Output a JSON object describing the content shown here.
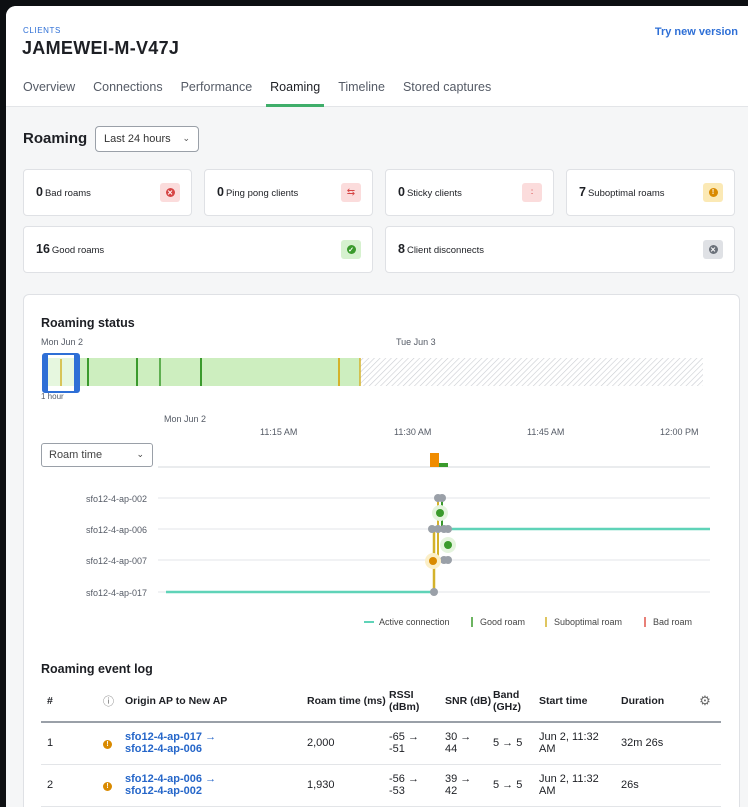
{
  "header": {
    "breadcrumb": "CLIENTS",
    "title": "JAMEWEI-M-V47J",
    "try_new": "Try new version"
  },
  "tabs": [
    {
      "label": "Overview"
    },
    {
      "label": "Connections"
    },
    {
      "label": "Performance"
    },
    {
      "label": "Roaming"
    },
    {
      "label": "Timeline"
    },
    {
      "label": "Stored captures"
    }
  ],
  "roaming": {
    "title": "Roaming",
    "range": "Last 24 hours"
  },
  "summary": [
    {
      "count": "0",
      "label": "Bad roams",
      "icon": "x-circle-icon"
    },
    {
      "count": "0",
      "label": "Ping pong clients",
      "icon": "ping-pong-icon"
    },
    {
      "count": "0",
      "label": "Sticky clients",
      "icon": "sticky-icon"
    },
    {
      "count": "7",
      "label": "Suboptimal roams",
      "icon": "warning-icon"
    },
    {
      "count": "16",
      "label": "Good roams",
      "icon": "check-circle-icon"
    },
    {
      "count": "8",
      "label": "Client disconnects",
      "icon": "disconnect-icon"
    }
  ],
  "status": {
    "title": "Roaming status",
    "day1": "Mon Jun 2",
    "day2": "Tue Jun 3",
    "window": "1 hour",
    "detail_date": "Mon Jun 2",
    "times": [
      "11:15 AM",
      "11:30 AM",
      "11:45 AM",
      "12:00 PM"
    ],
    "select": "Roam time",
    "aps": [
      "sfo12-4-ap-002",
      "sfo12-4-ap-006",
      "sfo12-4-ap-007",
      "sfo12-4-ap-017"
    ],
    "legend": [
      "Active connection",
      "Good roam",
      "Suboptimal roam",
      "Bad roam"
    ]
  },
  "colors": {
    "active": "#5fd3b8",
    "good": "#3a9a2c",
    "suboptimal": "#d4b22b",
    "bad": "#e0564a",
    "timeline_fill": "#cdeebf"
  },
  "log": {
    "title": "Roaming event log",
    "headers": {
      "num": "#",
      "path": "Origin AP to New AP",
      "roam_time": "Roam time (ms)",
      "rssi": "RSSI (dBm)",
      "snr": "SNR (dB)",
      "band": "Band (GHz)",
      "start": "Start time",
      "duration": "Duration"
    },
    "rows": [
      {
        "num": "1",
        "from": "sfo12-4-ap-017 →",
        "to": "sfo12-4-ap-006",
        "roam_time": "2,000",
        "rssi1": "-65 →",
        "rssi2": "-51",
        "snr1": "30 →",
        "snr2": "44",
        "band": "5 → 5",
        "start1": "Jun 2, 11:32",
        "start2": "AM",
        "duration": "32m 26s"
      },
      {
        "num": "2",
        "from": "sfo12-4-ap-006 →",
        "to": "sfo12-4-ap-002",
        "roam_time": "1,930",
        "rssi1": "-56 →",
        "rssi2": "-53",
        "snr1": "39 →",
        "snr2": "42",
        "band": "5 → 5",
        "start1": "Jun 2, 11:32",
        "start2": "AM",
        "duration": "26s"
      }
    ]
  }
}
